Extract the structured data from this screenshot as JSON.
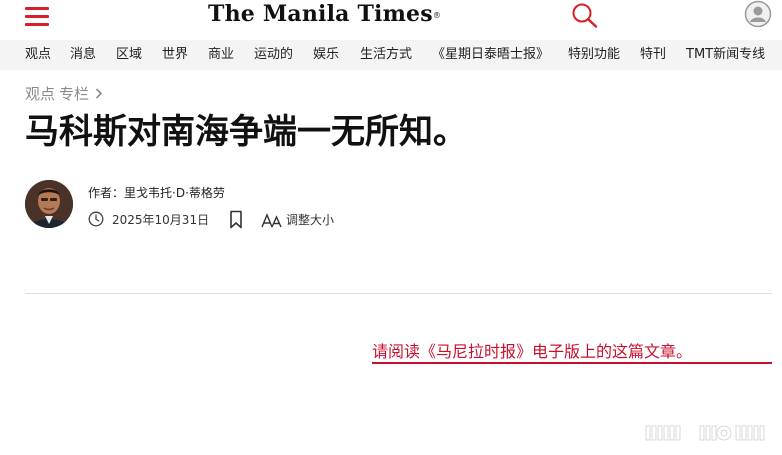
{
  "header": {
    "logo_text": "The Manila Times",
    "logo_reg": "®"
  },
  "nav": {
    "items": [
      {
        "label": "观点"
      },
      {
        "label": "消息"
      },
      {
        "label": "区域"
      },
      {
        "label": "世界"
      },
      {
        "label": "商业"
      },
      {
        "label": "运动的"
      },
      {
        "label": "娱乐"
      },
      {
        "label": "生活方式"
      },
      {
        "label": "《星期日泰晤士报》"
      },
      {
        "label": "特别功能"
      },
      {
        "label": "特刊"
      },
      {
        "label": "TMT新闻专线"
      }
    ]
  },
  "breadcrumb": {
    "part1": "观点",
    "part2": "专栏"
  },
  "article": {
    "title": "马科斯对南海争端一无所知。",
    "author_prefix": "作者：",
    "author_name": "里戈韦托·D·蒂格劳",
    "date": "2025年10月31日",
    "resize_label": "调整大小",
    "read_link": "请阅读《马尼拉时报》电子版上的这篇文章。"
  },
  "icons": {
    "menu": "hamburger-menu-icon",
    "search": "search-icon",
    "user": "user-icon",
    "clock": "clock-icon",
    "bookmark": "bookmark-icon",
    "font_size": "font-size-icon"
  },
  "colors": {
    "accent": "#d61f26",
    "link": "#c8102e",
    "nav_bg": "#f4f4f4",
    "muted": "#8a8a8a"
  }
}
